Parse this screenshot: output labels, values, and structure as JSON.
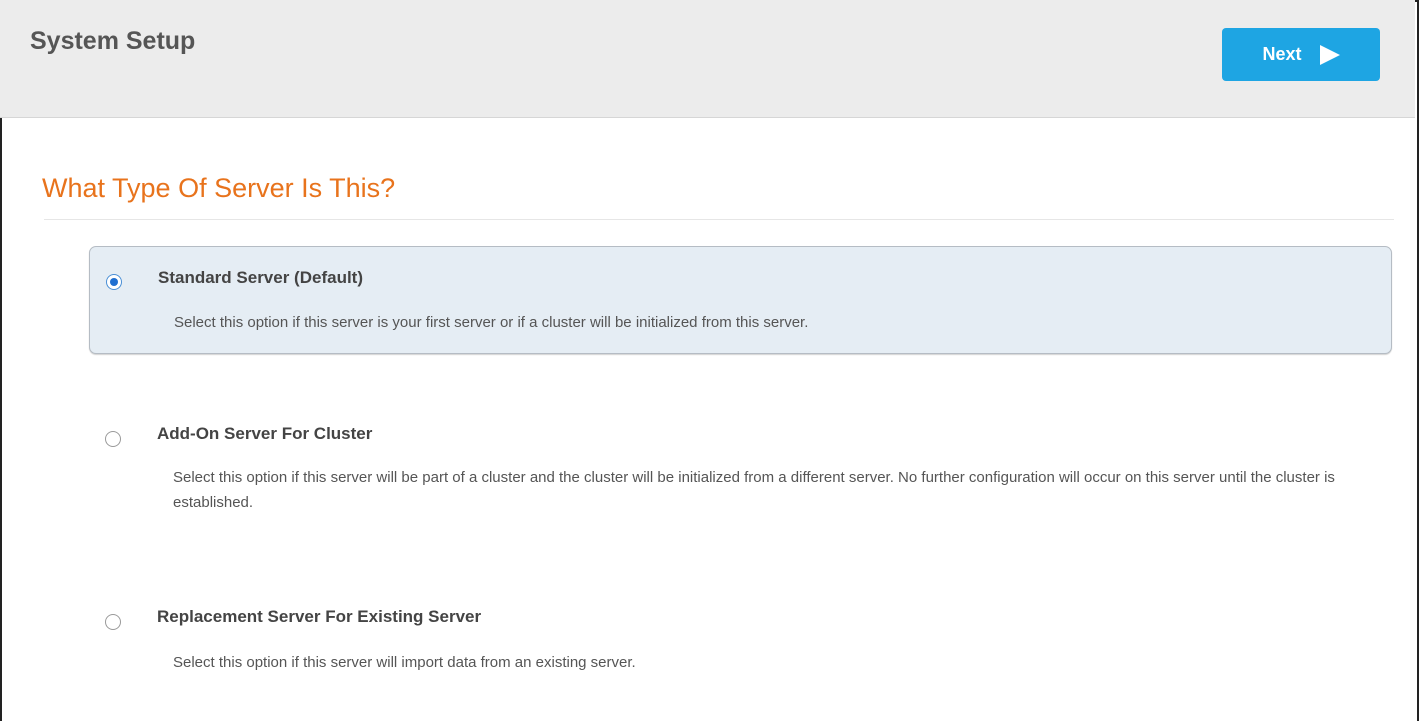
{
  "header": {
    "title": "System Setup",
    "next_label": "Next",
    "next_icon": "play-arrow-icon"
  },
  "section": {
    "title": "What Type Of Server Is This?"
  },
  "options": [
    {
      "title": "Standard Server (Default)",
      "description": "Select this option if this server is your first server or if a cluster will be initialized from this server.",
      "selected": true
    },
    {
      "title": "Add-On Server For Cluster",
      "description": "Select this option if this server will be part of a cluster and the cluster will be initialized from a different server. No further configuration will occur on this server until the cluster is established.",
      "selected": false
    },
    {
      "title": "Replacement Server For Existing Server",
      "description": "Select this option if this server will import data from an existing server.",
      "selected": false
    }
  ],
  "colors": {
    "accent": "#1ea5e3",
    "section_title": "#e8731c",
    "selected_option_bg": "#e5edf4",
    "radio_checked": "#1f6fd1"
  }
}
